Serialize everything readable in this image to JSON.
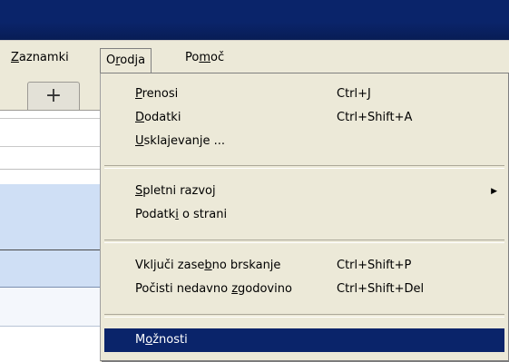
{
  "menubar": {
    "items": [
      {
        "label": "Zaznamki",
        "mn": "Z",
        "rest": "aznamki"
      },
      {
        "label": "Orodja",
        "pre": "O",
        "mn": "r",
        "rest": "odja"
      },
      {
        "label": "Pomoč",
        "pre": "Po",
        "mn": "m",
        "rest": "oč"
      }
    ]
  },
  "tabs": {
    "new_tab_symbol": "+"
  },
  "tools_menu": {
    "groups": [
      [
        {
          "pre": "",
          "mn": "P",
          "rest": "renosi",
          "shortcut": "Ctrl+J"
        },
        {
          "pre": "",
          "mn": "D",
          "rest": "odatki",
          "shortcut": "Ctrl+Shift+A"
        },
        {
          "pre": "",
          "mn": "U",
          "rest": "sklajevanje ...",
          "shortcut": ""
        }
      ],
      [
        {
          "pre": "",
          "mn": "S",
          "rest": "pletni razvoj",
          "shortcut": "",
          "submenu": "▶"
        },
        {
          "pre": "Podatk",
          "mn": "i",
          "rest": " o strani",
          "shortcut": ""
        }
      ],
      [
        {
          "pre": "Vključi zase",
          "mn": "b",
          "rest": "no brskanje",
          "shortcut": "Ctrl+Shift+P"
        },
        {
          "pre": "Počisti nedavno ",
          "mn": "z",
          "rest": "godovino",
          "shortcut": "Ctrl+Shift+Del"
        }
      ],
      [
        {
          "pre": "M",
          "mn": "o",
          "rest": "žnosti",
          "shortcut": "",
          "highlighted": true
        }
      ]
    ]
  },
  "colors": {
    "highlight": "#0a246a",
    "titlebar": "#0a246a",
    "menu_bg": "#ece9d8"
  }
}
